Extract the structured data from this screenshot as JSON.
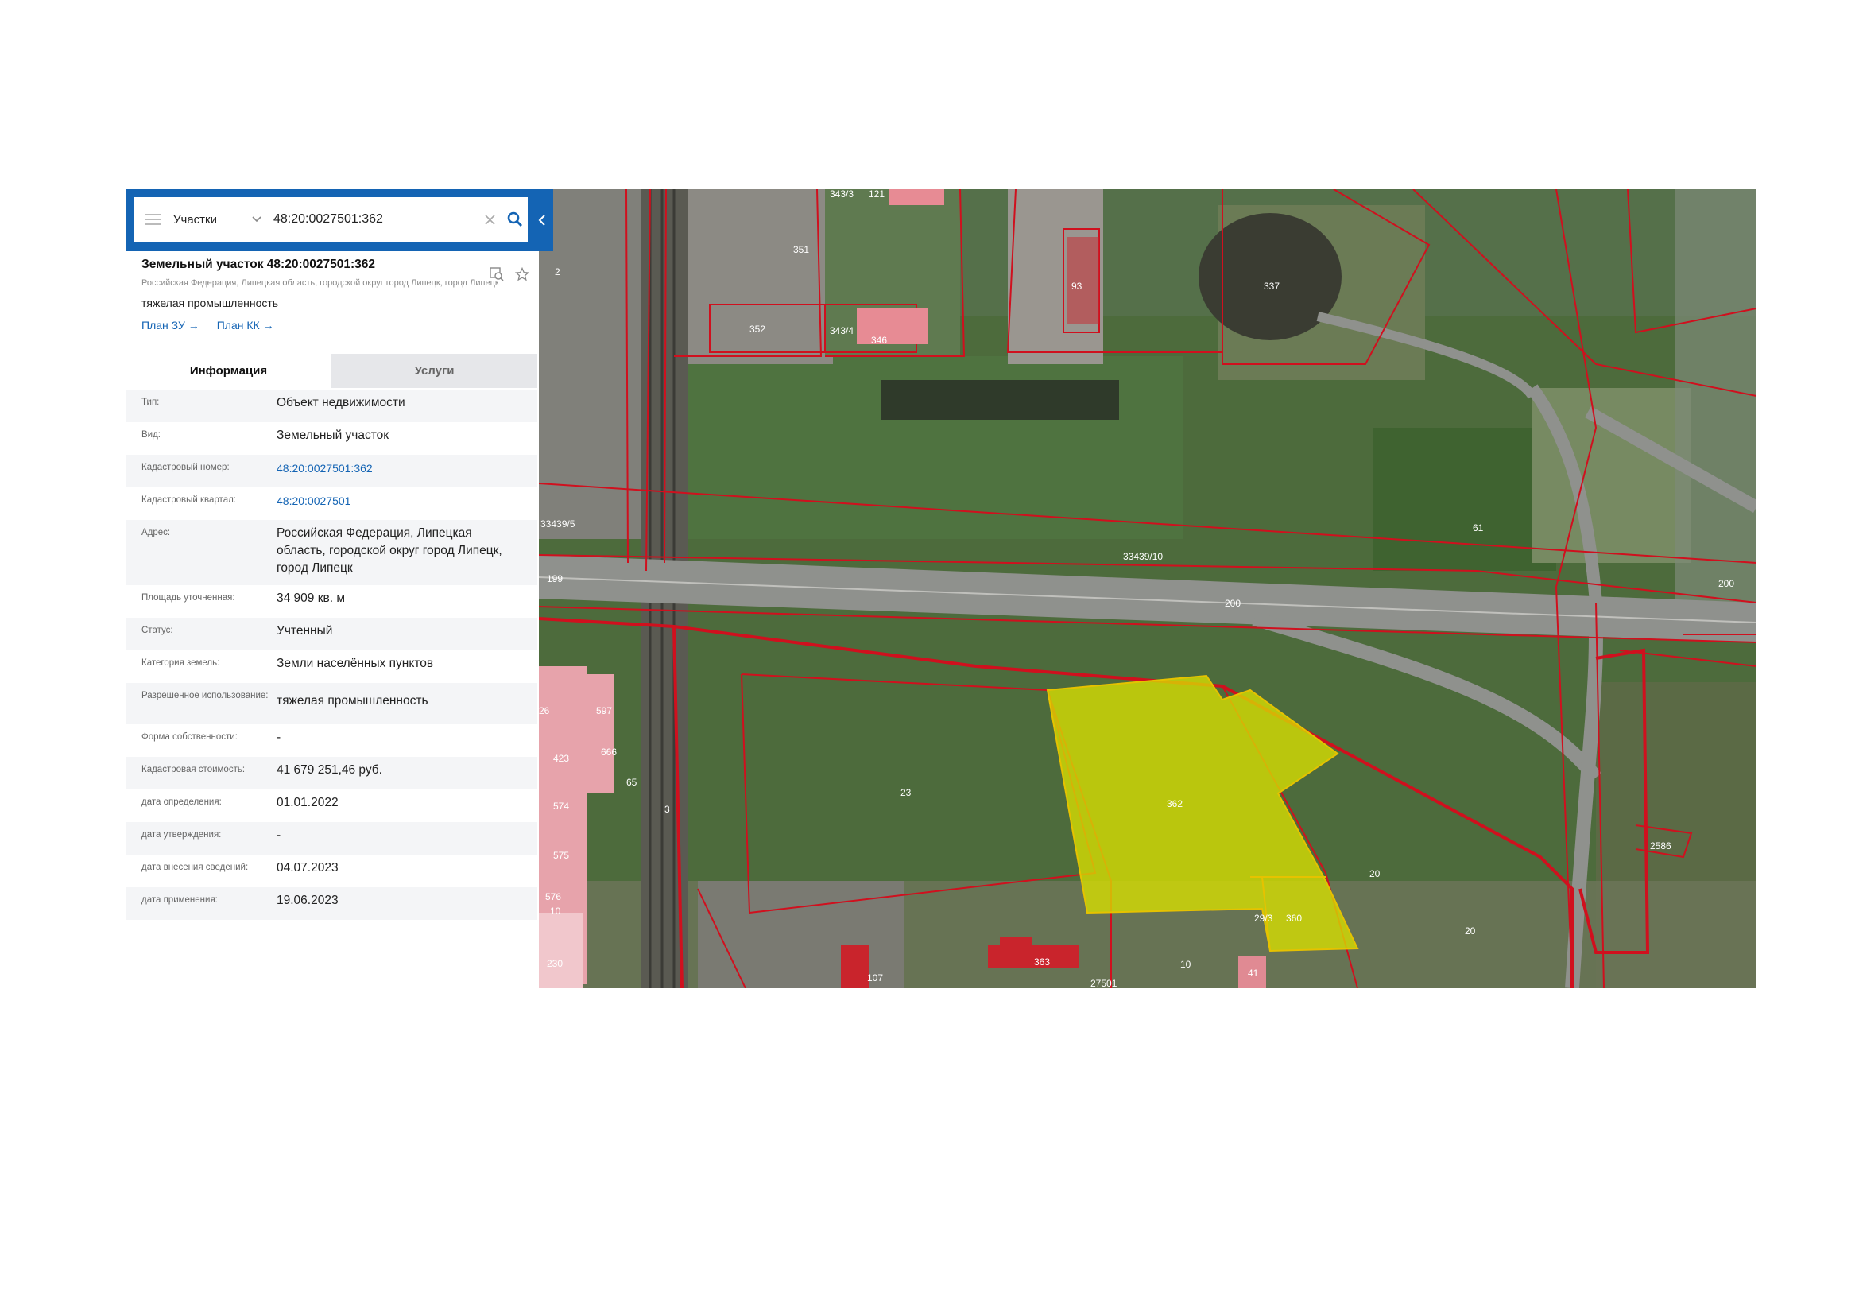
{
  "search": {
    "layer": "Участки",
    "query": "48:20:0027501:362"
  },
  "object": {
    "title": "Земельный участок 48:20:0027501:362",
    "address": "Российская Федерация, Липецкая область, городской округ город Липецк, город Липецк",
    "use": "тяжелая промышленность",
    "links": [
      "План ЗУ →",
      "План КК →"
    ]
  },
  "tabs": [
    "Информация",
    "Услуги"
  ],
  "info_rows": [
    {
      "label": "Тип:",
      "value": "Объект недвижимости"
    },
    {
      "label": "Вид:",
      "value": "Земельный участок"
    },
    {
      "label": "Кадастровый номер:",
      "value": "48:20:0027501:362"
    },
    {
      "label": "Кадастровый квартал:",
      "value": "48:20:0027501"
    },
    {
      "label": "Адрес:",
      "value": "Российская Федерация, Липецкая область, городской округ город Липецк, город Липецк"
    },
    {
      "label": "Площадь уточненная:",
      "value": "34 909 кв. м"
    },
    {
      "label": "Статус:",
      "value": "Учтенный"
    },
    {
      "label": "Категория земель:",
      "value": "Земли населённых пунктов"
    },
    {
      "label": "Разрешенное использование:",
      "value": "тяжелая промышленность"
    },
    {
      "label": "Форма собственности:",
      "value": "-"
    },
    {
      "label": "Кадастровая стоимость:",
      "value": "41 679 251,46 руб."
    },
    {
      "label": "дата определения:",
      "value": "01.01.2022"
    },
    {
      "label": "дата утверждения:",
      "value": "-"
    },
    {
      "label": "дата внесения сведений:",
      "value": "04.07.2023"
    },
    {
      "label": "дата применения:",
      "value": "19.06.2023"
    }
  ],
  "map_labels": {
    "l1": "343/3",
    "l2": "121",
    "l3": "351",
    "l4": "352",
    "l5": "343/4",
    "l6": "346",
    "l7": "93",
    "l8": "337",
    "l9": "33439/5",
    "l10": "199",
    "l11": "33439/10",
    "l12": "61",
    "l13": "200",
    "l14": "200",
    "l15": "597",
    "l16": "423",
    "l17": "574",
    "l18": "575",
    "l19": "576",
    "l20": "230",
    "l21": "3",
    "l22": "65",
    "l23": "23",
    "l24": "362",
    "l25": "29/3",
    "l26": "360",
    "l27": "20",
    "l28": "20",
    "l29": "2586",
    "l30": "363",
    "l31": "10",
    "l32": "107",
    "l33": "41",
    "l34": "27501",
    "l35": "26",
    "l36": "666",
    "l37": "10",
    "l38": "2"
  },
  "colors": {
    "accent": "#1464b4",
    "parcel_border": "#d0101e",
    "selected_parcel": "#d9e000"
  }
}
